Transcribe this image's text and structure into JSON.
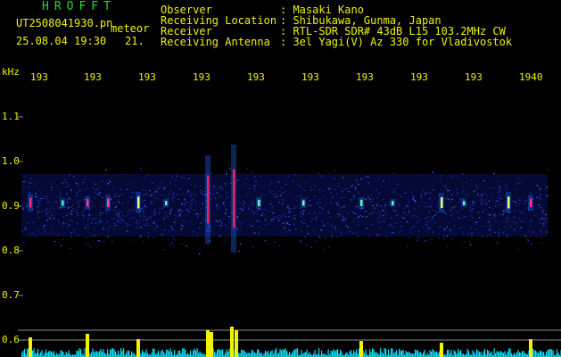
{
  "header": {
    "brand": "HROFFT",
    "filename": "UT2508041930.pn",
    "mode_label": "meteor",
    "datetime": "25.08.04 19:30",
    "count": "21.",
    "observer_label": "Observer",
    "observer_value": ": Masaki Kano",
    "location_label": "Receiving Location",
    "location_value": ": Shibukawa, Gunma, Japan",
    "receiver_label": "Receiver",
    "receiver_value": ": RTL-SDR SDR# 43dB L15 103.2MHz CW",
    "antenna_label": "Receiving Antenna",
    "antenna_value": ": 3el Yagi(V) Az 330 for Vladivostok"
  },
  "axis": {
    "unit": "kHz",
    "y_ticks": [
      "1.1",
      "1.0",
      "0.9",
      "0.8",
      "0.7",
      "0.6"
    ],
    "x_ticks": [
      "193",
      "193",
      "193",
      "193",
      "193",
      "193",
      "193",
      "193",
      "193",
      "1940"
    ]
  },
  "colors": {
    "text": "#f2f200",
    "brand": "#22dd22",
    "background": "#000000",
    "spectrum_base": "#0a1a8a",
    "noise": "#00e5ff",
    "peak": "#f2f200"
  }
}
